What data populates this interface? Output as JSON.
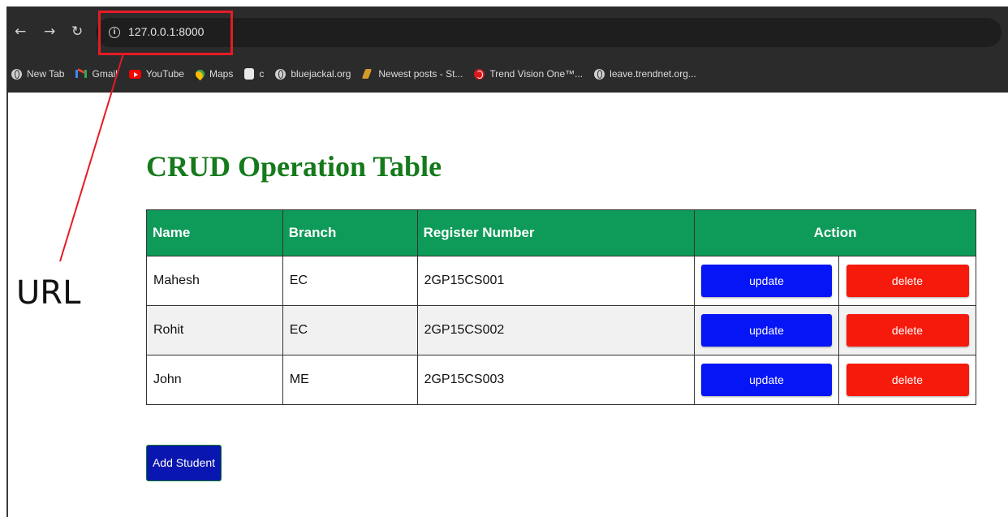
{
  "browser": {
    "nav": {
      "back": "←",
      "forward": "→",
      "reload": "↻"
    },
    "url": "127.0.0.1:8000",
    "bookmarks": [
      {
        "label": "New Tab",
        "icon": "globe-icon"
      },
      {
        "label": "Gmail",
        "icon": "gmail-icon"
      },
      {
        "label": "YouTube",
        "icon": "youtube-icon"
      },
      {
        "label": "Maps",
        "icon": "maps-icon"
      },
      {
        "label": "c",
        "icon": "document-icon"
      },
      {
        "label": "bluejackal.org",
        "icon": "globe-icon"
      },
      {
        "label": "Newest posts - St...",
        "icon": "stackoverflow-icon"
      },
      {
        "label": "Trend Vision One™...",
        "icon": "trend-micro-icon"
      },
      {
        "label": "leave.trendnet.org...",
        "icon": "globe-icon"
      }
    ]
  },
  "annotation": {
    "label": "URL",
    "color": "#e51b24"
  },
  "page": {
    "title": "CRUD Operation Table",
    "title_color": "#157a1b",
    "table": {
      "headers": [
        "Name",
        "Branch",
        "Register Number",
        "Action"
      ],
      "header_color": "#0e9a58",
      "rows": [
        {
          "name": "Mahesh",
          "branch": "EC",
          "reg": "2GP15CS001"
        },
        {
          "name": "Rohit",
          "branch": "EC",
          "reg": "2GP15CS002"
        },
        {
          "name": "John",
          "branch": "ME",
          "reg": "2GP15CS003"
        }
      ],
      "update_label": "update",
      "delete_label": "delete",
      "update_color": "#0515f5",
      "delete_color": "#f51a0c"
    },
    "add_button": "Add Student"
  }
}
